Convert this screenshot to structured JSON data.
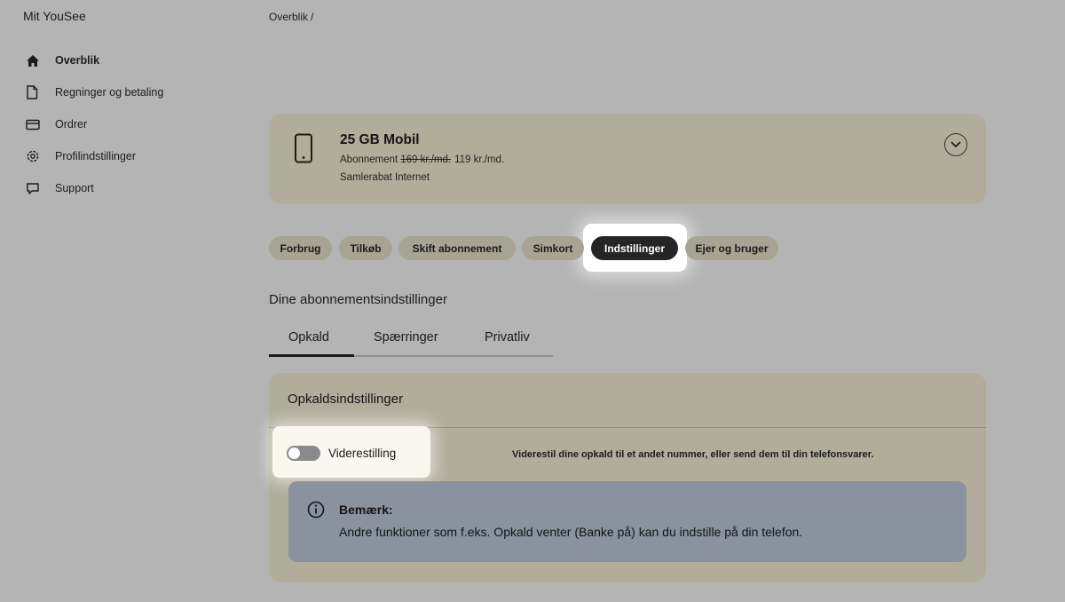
{
  "app": {
    "title": "Mit YouSee"
  },
  "sidebar": {
    "items": [
      {
        "label": "Overblik",
        "icon": "home-icon",
        "active": true
      },
      {
        "label": "Regninger og betaling",
        "icon": "document-icon"
      },
      {
        "label": "Ordrer",
        "icon": "card-icon"
      },
      {
        "label": "Profilindstillinger",
        "icon": "gear-icon"
      },
      {
        "label": "Support",
        "icon": "chat-icon"
      }
    ]
  },
  "breadcrumb": {
    "item": "Overblik",
    "separator": "/"
  },
  "subscription": {
    "title": "25 GB Mobil",
    "price_label": "Abonnement",
    "old_price": "169 kr./md.",
    "new_price": "119 kr./md.",
    "discount": "Samlerabat Internet",
    "icon": "phone-icon"
  },
  "pills": [
    {
      "label": "Forbrug"
    },
    {
      "label": "Tilkøb"
    },
    {
      "label": "Skift abonnement"
    },
    {
      "label": "Simkort"
    },
    {
      "label": "Indstillinger",
      "active": true
    },
    {
      "label": "Ejer og bruger"
    }
  ],
  "section": {
    "heading": "Dine abonnementsindstillinger"
  },
  "tabs": [
    {
      "label": "Opkald",
      "active": true
    },
    {
      "label": "Spærringer"
    },
    {
      "label": "Privatliv"
    }
  ],
  "call_settings": {
    "title": "Opkaldsindstillinger",
    "toggle_label": "Viderestilling",
    "toggle_on": false,
    "description": "Viderestil dine opkald til et andet nummer, eller send dem til din telefonsvarer."
  },
  "note": {
    "title": "Bemærk:",
    "body": "Andre funktioner som f.eks. Opkald venter (Banke på) kan du indstille på din telefon.",
    "icon": "info-icon"
  },
  "colors": {
    "background": "#b4b4b4",
    "card": "#b2ad9b",
    "pill": "#a8a493",
    "pill_active": "#252525",
    "note": "#8a92a0",
    "highlight": "#ffffff"
  }
}
